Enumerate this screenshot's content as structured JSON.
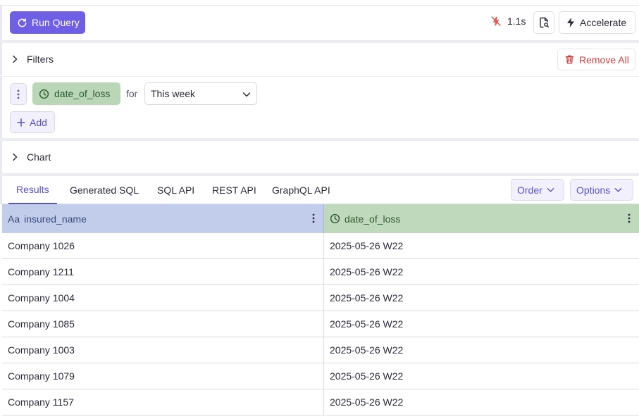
{
  "toolbar": {
    "run_label": "Run Query",
    "timing": "1.1s",
    "accelerate_label": "Accelerate"
  },
  "filters_section": {
    "title": "Filters",
    "remove_all_label": "Remove All",
    "filter": {
      "member": "date_of_loss",
      "for_label": "for",
      "selected_range": "This week"
    },
    "add_label": "Add"
  },
  "chart_section": {
    "title": "Chart"
  },
  "tabs": {
    "items": [
      {
        "label": "Results"
      },
      {
        "label": "Generated SQL"
      },
      {
        "label": "SQL API"
      },
      {
        "label": "REST API"
      },
      {
        "label": "GraphQL API"
      }
    ],
    "active": "Results",
    "order_label": "Order",
    "options_label": "Options"
  },
  "grid": {
    "columns": [
      {
        "type_icon": "Aa",
        "name": "insured_name"
      },
      {
        "type_icon": "clock-icon",
        "name": "date_of_loss"
      }
    ],
    "rows": [
      [
        "Company 1026",
        "2025-05-26 W22"
      ],
      [
        "Company 1211",
        "2025-05-26 W22"
      ],
      [
        "Company 1004",
        "2025-05-26 W22"
      ],
      [
        "Company 1085",
        "2025-05-26 W22"
      ],
      [
        "Company 1003",
        "2025-05-26 W22"
      ],
      [
        "Company 1079",
        "2025-05-26 W22"
      ],
      [
        "Company 1157",
        "2025-05-26 W22"
      ]
    ]
  },
  "colors": {
    "primary": "#6f5ee6",
    "danger": "#d23b3b",
    "dimension_header": "#c2cceb",
    "time_header": "#bfd9bd"
  }
}
